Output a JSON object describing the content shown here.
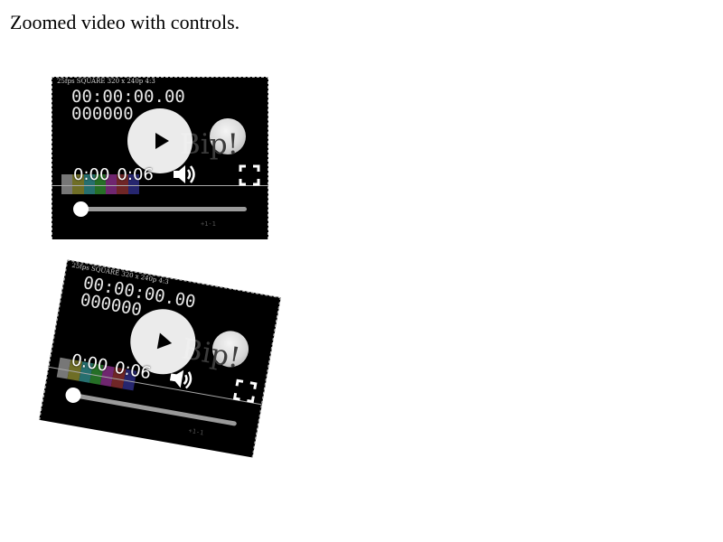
{
  "page": {
    "caption": "Zoomed video with controls."
  },
  "players": [
    {
      "meta": "25fps  SQUARE  320 x 240p  4:3",
      "timecode": "00:00:00.00",
      "frame_count": "000000",
      "overlay_text": "Bip!",
      "current_time": "0:00",
      "duration": "0:06",
      "bottom_label": "+1-1",
      "progress": 0,
      "icons": {
        "play": "play-icon",
        "volume": "volume-icon",
        "fullscreen": "fullscreen-icon"
      }
    },
    {
      "meta": "25fps  SQUARE  320 x 240p  4:3",
      "timecode": "00:00:00.00",
      "frame_count": "000000",
      "overlay_text": "Bip!",
      "current_time": "0:00",
      "duration": "0:06",
      "bottom_label": "+1-1",
      "progress": 0,
      "icons": {
        "play": "play-icon",
        "volume": "volume-icon",
        "fullscreen": "fullscreen-icon"
      }
    }
  ]
}
